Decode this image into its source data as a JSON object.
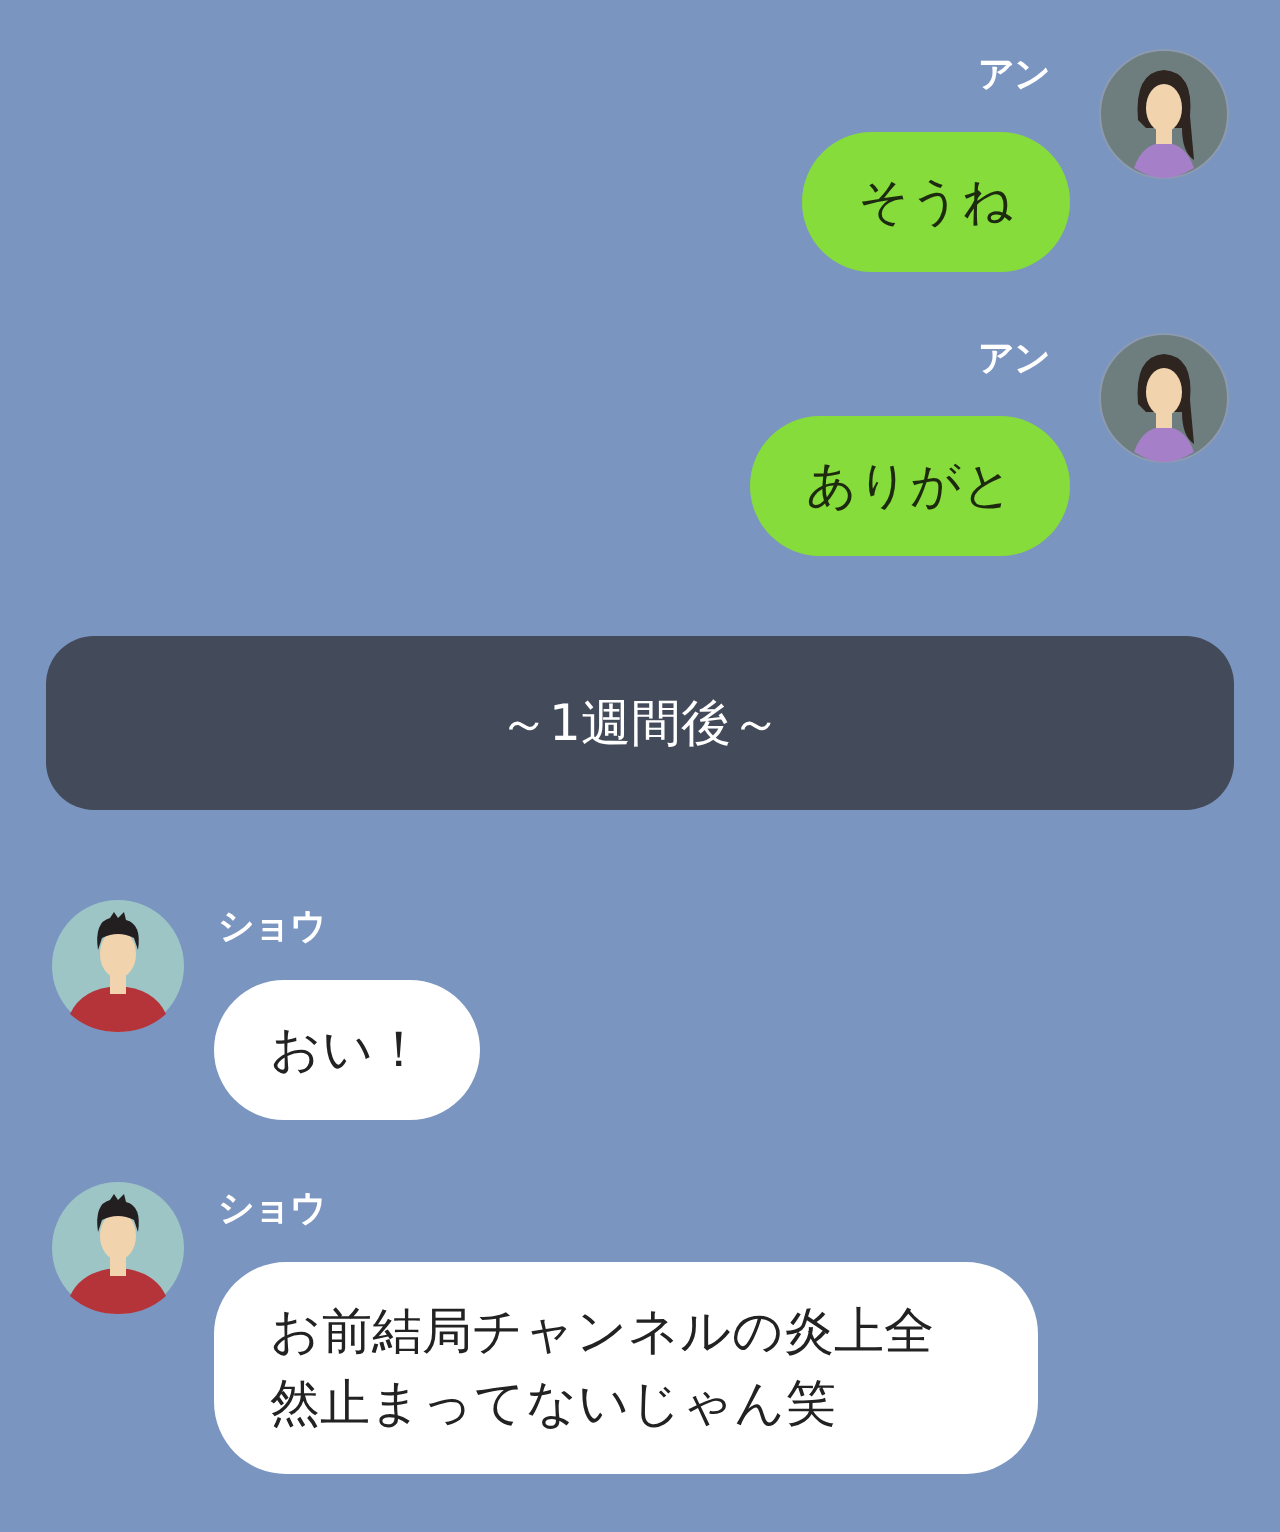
{
  "messages": [
    {
      "kind": "message",
      "outgoing": true,
      "sender": "アン",
      "text": "そうね"
    },
    {
      "kind": "message",
      "outgoing": true,
      "sender": "アン",
      "text": "ありがと"
    },
    {
      "kind": "divider",
      "text": "～1週間後～"
    },
    {
      "kind": "message",
      "outgoing": false,
      "sender": "ショウ",
      "text": "おい！"
    },
    {
      "kind": "message",
      "outgoing": false,
      "sender": "ショウ",
      "text": "お前結局チャンネルの炎上全然止まってないじゃん笑"
    }
  ]
}
